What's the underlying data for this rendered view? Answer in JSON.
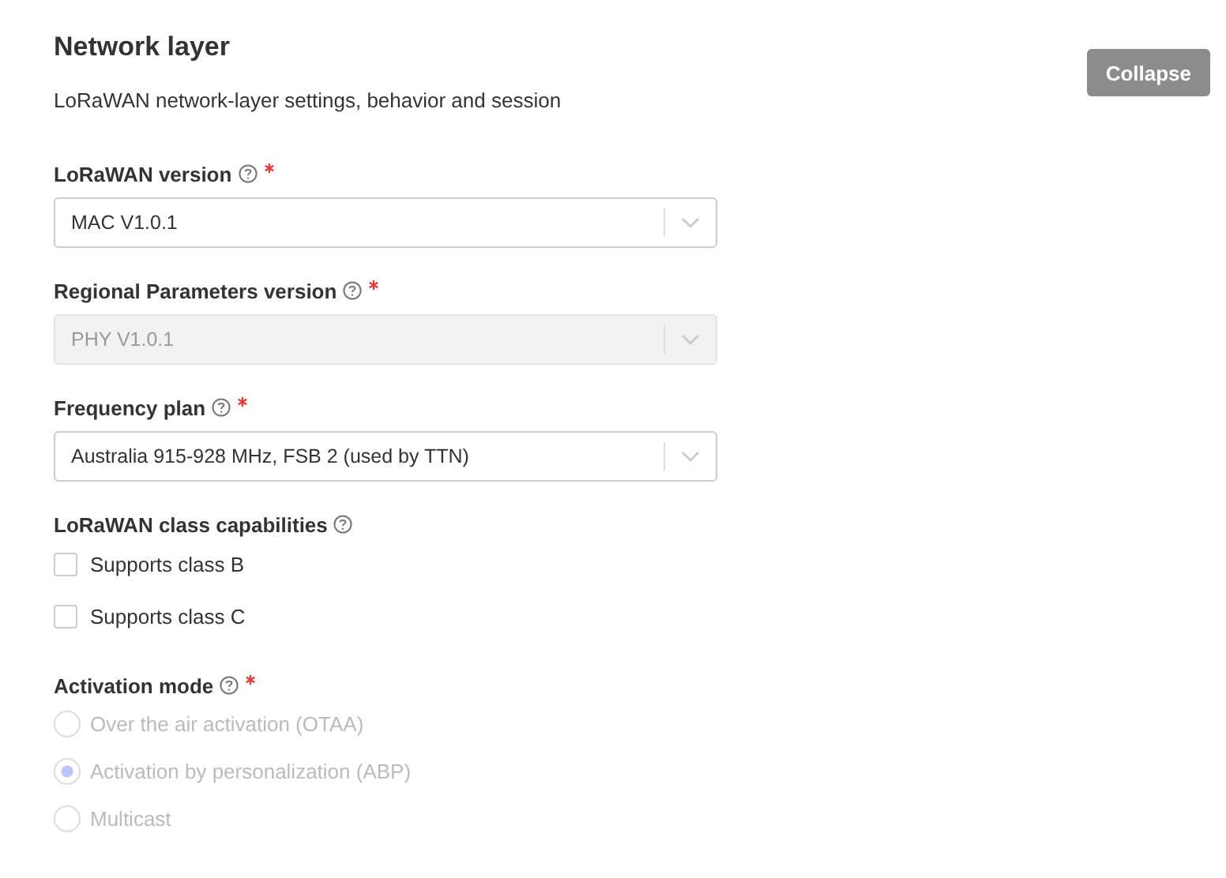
{
  "section": {
    "title": "Network layer",
    "description": "LoRaWAN network-layer settings, behavior and session",
    "collapse_button": "Collapse"
  },
  "fields": [
    {
      "kind": "select",
      "label": "LoRaWAN version",
      "required": true,
      "value": "MAC V1.0.1",
      "disabled": false
    },
    {
      "kind": "select",
      "label": "Regional Parameters version",
      "required": true,
      "value": "PHY V1.0.1",
      "disabled": true
    },
    {
      "kind": "select",
      "label": "Frequency plan",
      "required": true,
      "value": "Australia 915-928 MHz, FSB 2 (used by TTN)",
      "disabled": false
    },
    {
      "kind": "checkboxes",
      "label": "LoRaWAN class capabilities",
      "required": false,
      "options": [
        {
          "label": "Supports class B",
          "checked": false,
          "disabled": false
        },
        {
          "label": "Supports class C",
          "checked": false,
          "disabled": false
        }
      ]
    },
    {
      "kind": "radios",
      "label": "Activation mode",
      "required": true,
      "options": [
        {
          "label": "Over the air activation (OTAA)",
          "selected": false,
          "disabled": true
        },
        {
          "label": "Activation by personalization (ABP)",
          "selected": true,
          "disabled": true
        },
        {
          "label": "Multicast",
          "selected": false,
          "disabled": true
        }
      ]
    }
  ]
}
